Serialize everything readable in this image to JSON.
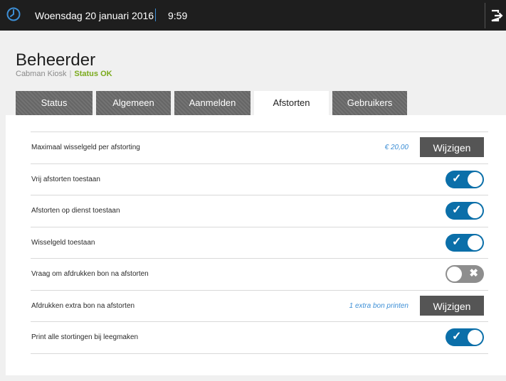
{
  "header": {
    "date": "Woensdag 20 januari 2016",
    "time": "9:59",
    "clock_icon": "clock-icon",
    "logout_icon": "logout-icon"
  },
  "page": {
    "title": "Beheerder",
    "device": "Cabman Kiosk",
    "status": "Status OK"
  },
  "tabs": [
    {
      "label": "Status",
      "active": false
    },
    {
      "label": "Algemeen",
      "active": false
    },
    {
      "label": "Aanmelden",
      "active": false
    },
    {
      "label": "Afstorten",
      "active": true
    },
    {
      "label": "Gebruikers",
      "active": false
    }
  ],
  "settings": [
    {
      "label": "Maximaal wisselgeld per afstorting",
      "value": "€ 20,00",
      "button": "Wijzigen"
    },
    {
      "label": "Vrij afstorten toestaan",
      "toggle": true
    },
    {
      "label": "Afstorten op dienst toestaan",
      "toggle": true
    },
    {
      "label": "Wisselgeld toestaan",
      "toggle": true
    },
    {
      "label": "Vraag om afdrukken bon na afstorten",
      "toggle": false
    },
    {
      "label": "Afdrukken extra bon na afstorten",
      "value": "1 extra bon printen",
      "button": "Wijzigen"
    },
    {
      "label": "Print alle stortingen bij leegmaken",
      "toggle": true
    }
  ],
  "colors": {
    "accent": "#0b6fa9",
    "status_ok": "#7aaa1c",
    "link_value": "#3d8fd6"
  }
}
